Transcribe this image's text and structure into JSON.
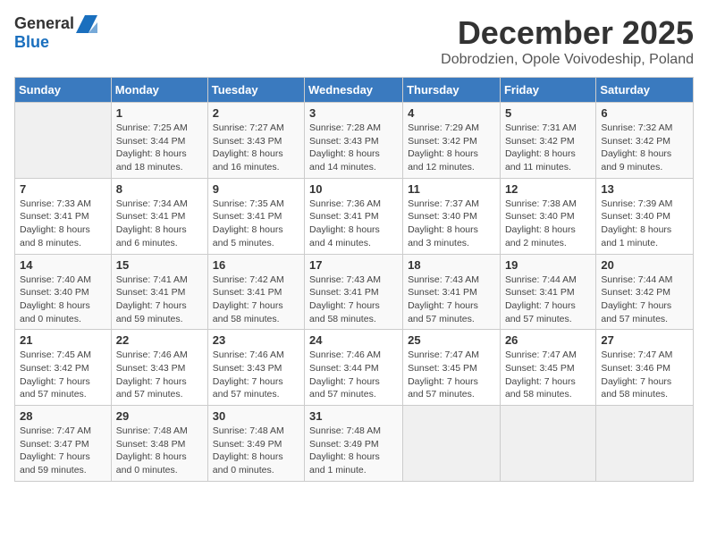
{
  "logo": {
    "general": "General",
    "blue": "Blue"
  },
  "title": "December 2025",
  "location": "Dobrodzien, Opole Voivodeship, Poland",
  "days_header": [
    "Sunday",
    "Monday",
    "Tuesday",
    "Wednesday",
    "Thursday",
    "Friday",
    "Saturday"
  ],
  "weeks": [
    [
      {
        "day": "",
        "info": ""
      },
      {
        "day": "1",
        "info": "Sunrise: 7:25 AM\nSunset: 3:44 PM\nDaylight: 8 hours\nand 18 minutes."
      },
      {
        "day": "2",
        "info": "Sunrise: 7:27 AM\nSunset: 3:43 PM\nDaylight: 8 hours\nand 16 minutes."
      },
      {
        "day": "3",
        "info": "Sunrise: 7:28 AM\nSunset: 3:43 PM\nDaylight: 8 hours\nand 14 minutes."
      },
      {
        "day": "4",
        "info": "Sunrise: 7:29 AM\nSunset: 3:42 PM\nDaylight: 8 hours\nand 12 minutes."
      },
      {
        "day": "5",
        "info": "Sunrise: 7:31 AM\nSunset: 3:42 PM\nDaylight: 8 hours\nand 11 minutes."
      },
      {
        "day": "6",
        "info": "Sunrise: 7:32 AM\nSunset: 3:42 PM\nDaylight: 8 hours\nand 9 minutes."
      }
    ],
    [
      {
        "day": "7",
        "info": "Sunrise: 7:33 AM\nSunset: 3:41 PM\nDaylight: 8 hours\nand 8 minutes."
      },
      {
        "day": "8",
        "info": "Sunrise: 7:34 AM\nSunset: 3:41 PM\nDaylight: 8 hours\nand 6 minutes."
      },
      {
        "day": "9",
        "info": "Sunrise: 7:35 AM\nSunset: 3:41 PM\nDaylight: 8 hours\nand 5 minutes."
      },
      {
        "day": "10",
        "info": "Sunrise: 7:36 AM\nSunset: 3:41 PM\nDaylight: 8 hours\nand 4 minutes."
      },
      {
        "day": "11",
        "info": "Sunrise: 7:37 AM\nSunset: 3:40 PM\nDaylight: 8 hours\nand 3 minutes."
      },
      {
        "day": "12",
        "info": "Sunrise: 7:38 AM\nSunset: 3:40 PM\nDaylight: 8 hours\nand 2 minutes."
      },
      {
        "day": "13",
        "info": "Sunrise: 7:39 AM\nSunset: 3:40 PM\nDaylight: 8 hours\nand 1 minute."
      }
    ],
    [
      {
        "day": "14",
        "info": "Sunrise: 7:40 AM\nSunset: 3:40 PM\nDaylight: 8 hours\nand 0 minutes."
      },
      {
        "day": "15",
        "info": "Sunrise: 7:41 AM\nSunset: 3:41 PM\nDaylight: 7 hours\nand 59 minutes."
      },
      {
        "day": "16",
        "info": "Sunrise: 7:42 AM\nSunset: 3:41 PM\nDaylight: 7 hours\nand 58 minutes."
      },
      {
        "day": "17",
        "info": "Sunrise: 7:43 AM\nSunset: 3:41 PM\nDaylight: 7 hours\nand 58 minutes."
      },
      {
        "day": "18",
        "info": "Sunrise: 7:43 AM\nSunset: 3:41 PM\nDaylight: 7 hours\nand 57 minutes."
      },
      {
        "day": "19",
        "info": "Sunrise: 7:44 AM\nSunset: 3:41 PM\nDaylight: 7 hours\nand 57 minutes."
      },
      {
        "day": "20",
        "info": "Sunrise: 7:44 AM\nSunset: 3:42 PM\nDaylight: 7 hours\nand 57 minutes."
      }
    ],
    [
      {
        "day": "21",
        "info": "Sunrise: 7:45 AM\nSunset: 3:42 PM\nDaylight: 7 hours\nand 57 minutes."
      },
      {
        "day": "22",
        "info": "Sunrise: 7:46 AM\nSunset: 3:43 PM\nDaylight: 7 hours\nand 57 minutes."
      },
      {
        "day": "23",
        "info": "Sunrise: 7:46 AM\nSunset: 3:43 PM\nDaylight: 7 hours\nand 57 minutes."
      },
      {
        "day": "24",
        "info": "Sunrise: 7:46 AM\nSunset: 3:44 PM\nDaylight: 7 hours\nand 57 minutes."
      },
      {
        "day": "25",
        "info": "Sunrise: 7:47 AM\nSunset: 3:45 PM\nDaylight: 7 hours\nand 57 minutes."
      },
      {
        "day": "26",
        "info": "Sunrise: 7:47 AM\nSunset: 3:45 PM\nDaylight: 7 hours\nand 58 minutes."
      },
      {
        "day": "27",
        "info": "Sunrise: 7:47 AM\nSunset: 3:46 PM\nDaylight: 7 hours\nand 58 minutes."
      }
    ],
    [
      {
        "day": "28",
        "info": "Sunrise: 7:47 AM\nSunset: 3:47 PM\nDaylight: 7 hours\nand 59 minutes."
      },
      {
        "day": "29",
        "info": "Sunrise: 7:48 AM\nSunset: 3:48 PM\nDaylight: 8 hours\nand 0 minutes."
      },
      {
        "day": "30",
        "info": "Sunrise: 7:48 AM\nSunset: 3:49 PM\nDaylight: 8 hours\nand 0 minutes."
      },
      {
        "day": "31",
        "info": "Sunrise: 7:48 AM\nSunset: 3:49 PM\nDaylight: 8 hours\nand 1 minute."
      },
      {
        "day": "",
        "info": ""
      },
      {
        "day": "",
        "info": ""
      },
      {
        "day": "",
        "info": ""
      }
    ]
  ]
}
